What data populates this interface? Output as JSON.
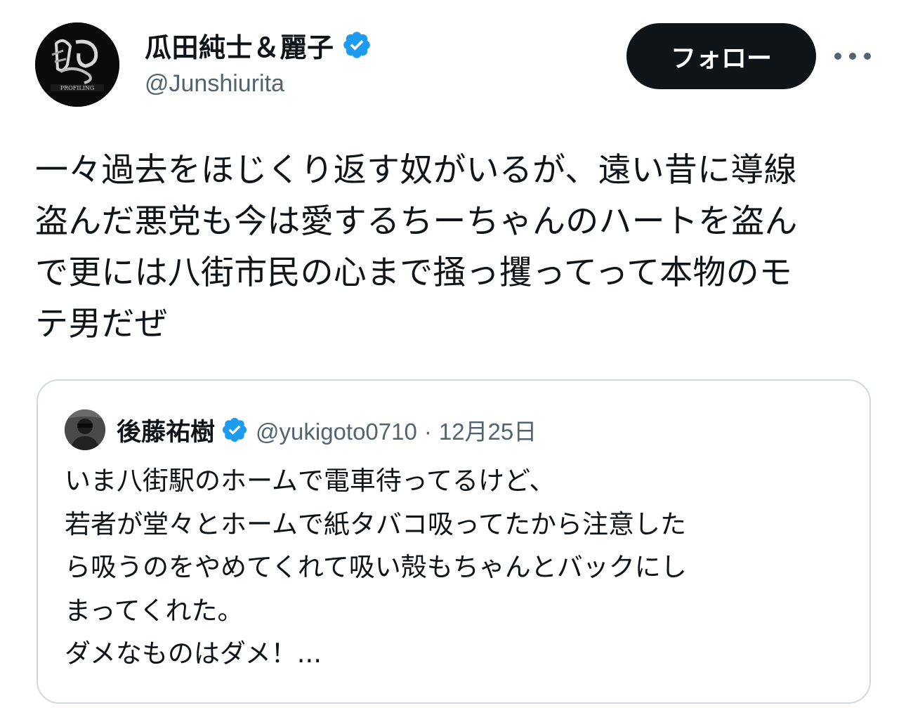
{
  "author": {
    "display_name": "瓜田純士＆麗子",
    "handle": "@Junshiurita",
    "verified": true,
    "avatar_icon": "profile-photo-logo",
    "avatar_caption": "PROFILING"
  },
  "actions": {
    "follow_label": "フォロー",
    "more_icon": "more-horizontal-icon"
  },
  "tweet": {
    "lines": [
      "一々過去をほじくり返す奴がいるが、遠い昔に導線",
      "盗んだ悪党も今は愛するちーちゃんのハートを盗ん",
      "で更には八街市民の心まで掻っ攫ってって本物のモ",
      "テ男だぜ"
    ]
  },
  "quoted_tweet": {
    "display_name": "後藤祐樹",
    "handle": "@yukigoto0710",
    "separator": "·",
    "date": "12月25日",
    "verified": true,
    "lines": [
      "いま八街駅のホームで電車待ってるけど、",
      "若者が堂々とホームで紙タバコ吸ってたから注意した",
      "ら吸うのをやめてくれて吸い殻もちゃんとバックにし",
      "まってくれた。",
      "ダメなものはダメ！..."
    ]
  },
  "colors": {
    "verified_blue": "#1d9bf0",
    "text_primary": "#0f1419",
    "text_secondary": "#536471",
    "border": "#cfd9de",
    "button_bg": "#0f1419"
  }
}
